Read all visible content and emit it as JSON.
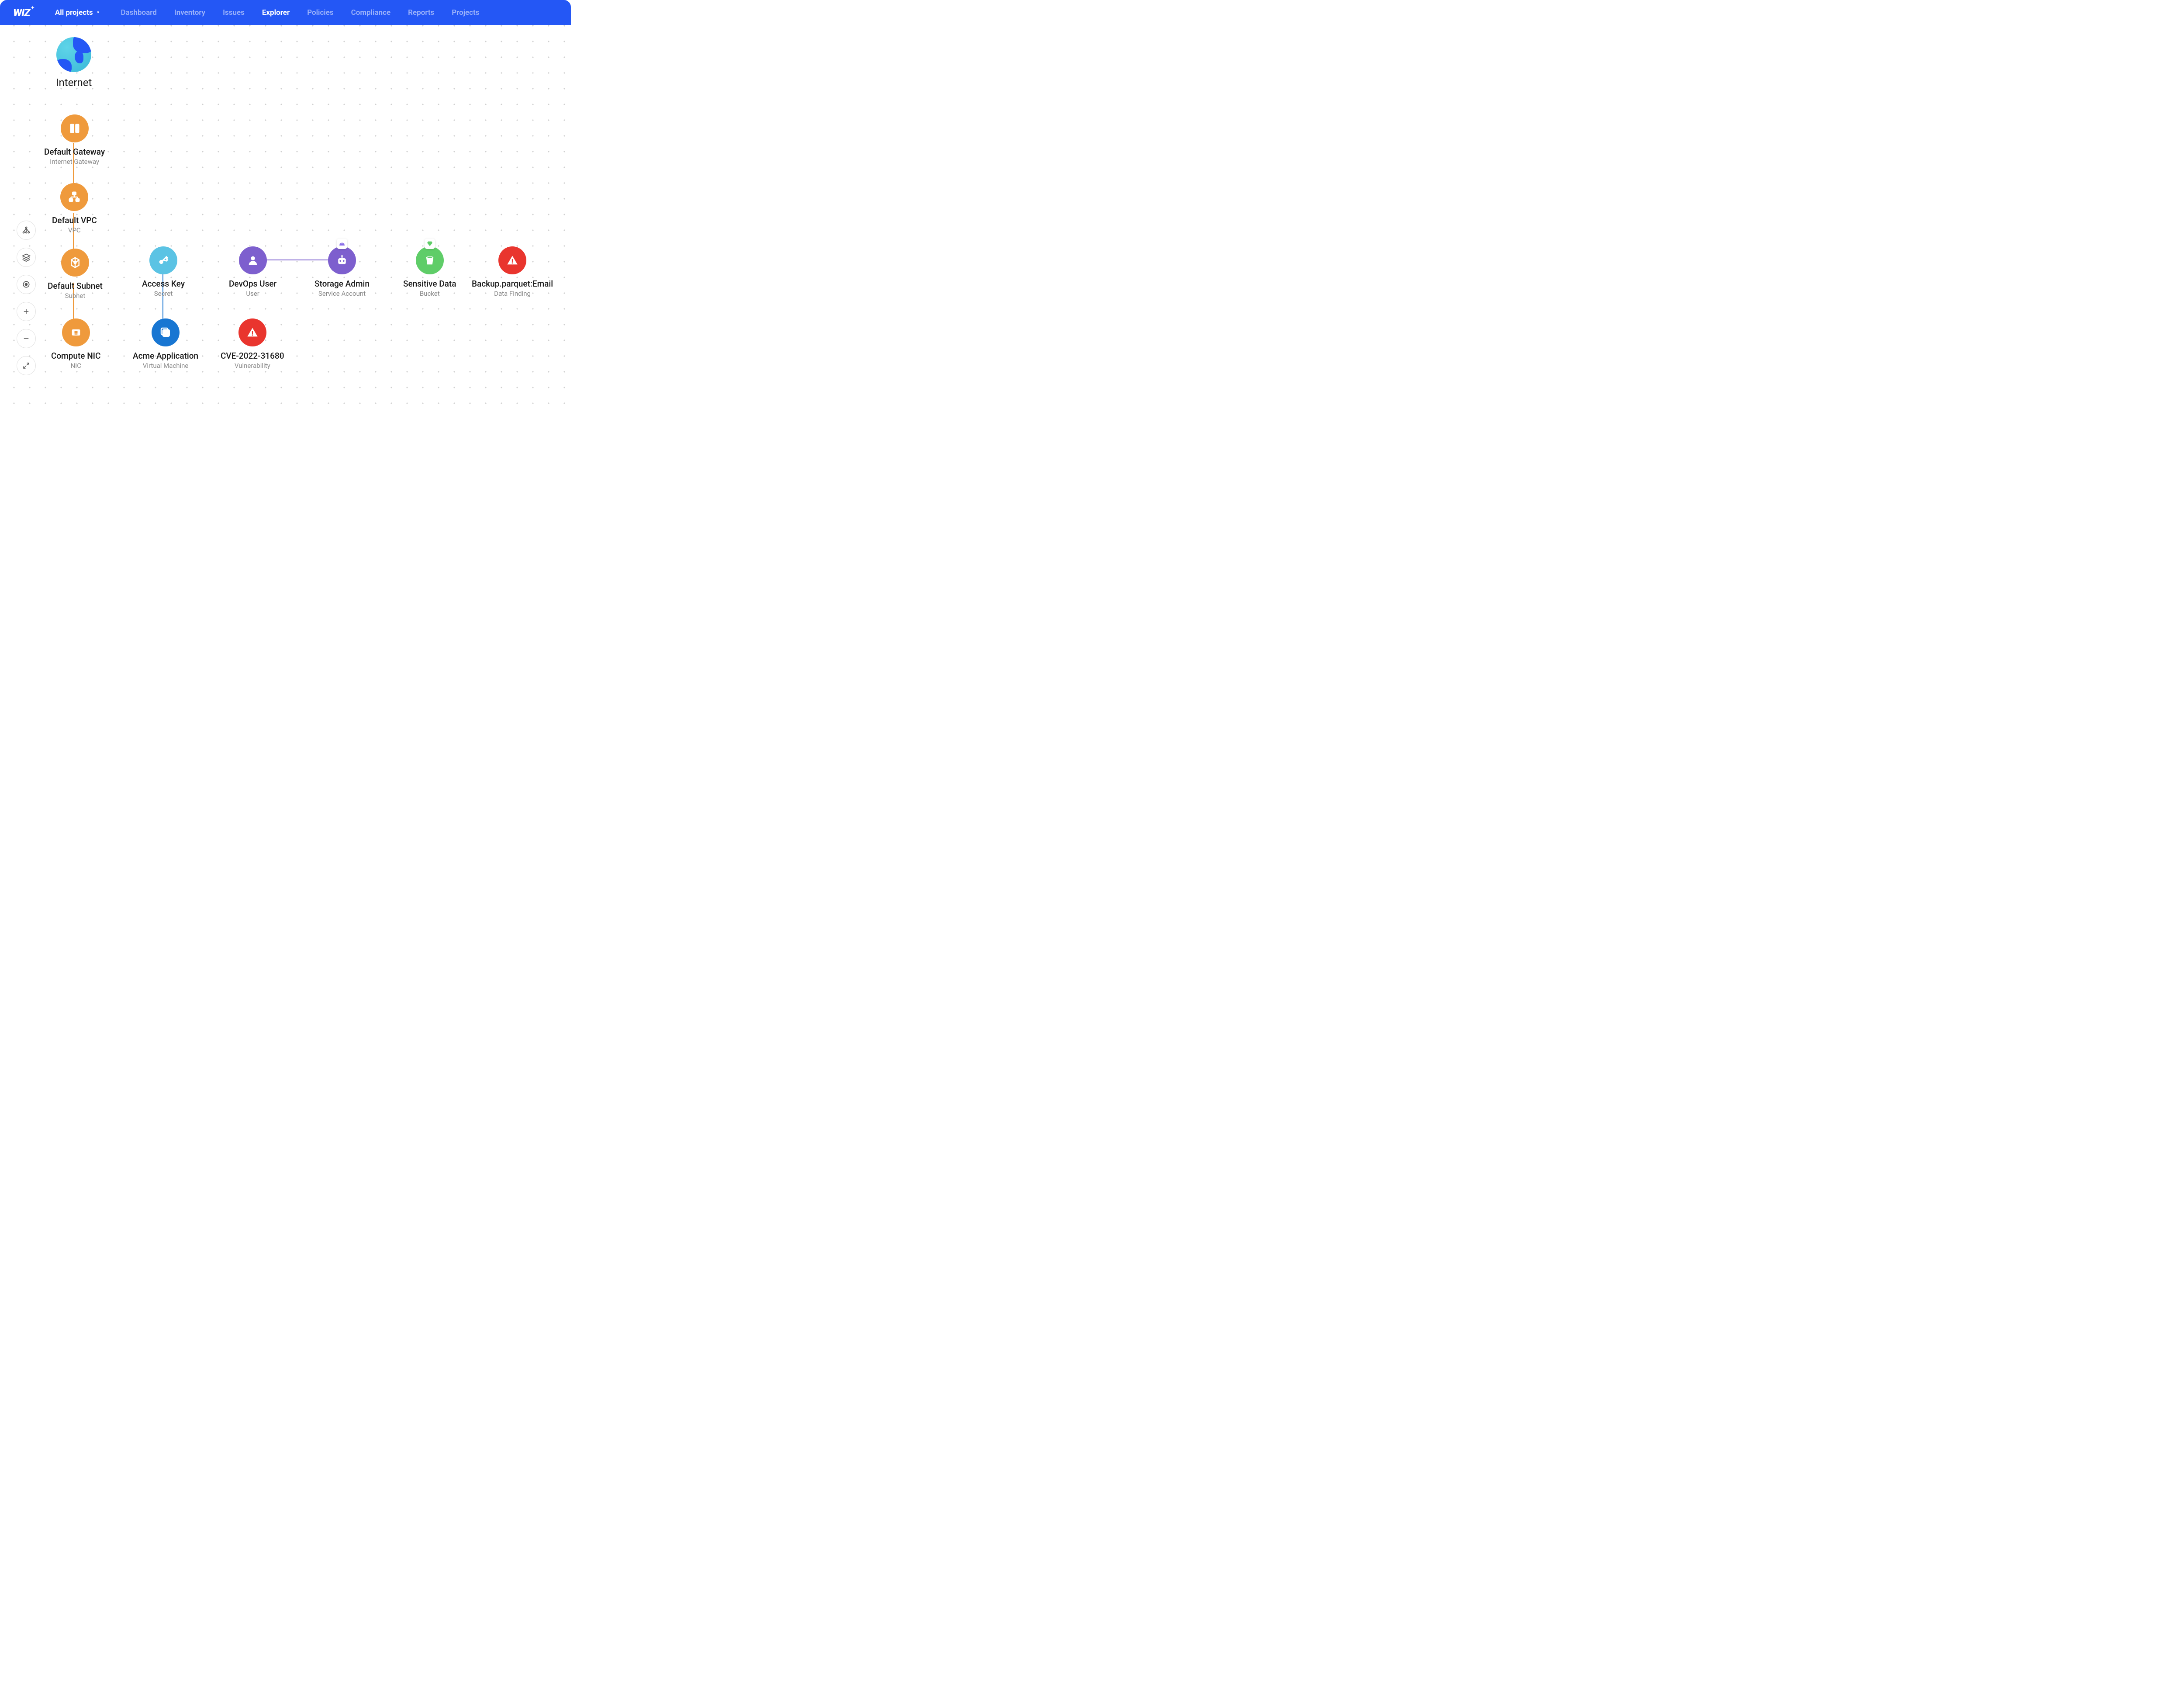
{
  "header": {
    "logo": "WIZ",
    "project_selector": "All projects",
    "nav": [
      "Dashboard",
      "Inventory",
      "Issues",
      "Explorer",
      "Policies",
      "Compliance",
      "Reports",
      "Projects"
    ],
    "active_nav": "Explorer"
  },
  "nodes": {
    "internet": {
      "title": "Internet",
      "subtitle": ""
    },
    "gateway": {
      "title": "Default Gateway",
      "subtitle": "Internet Gateway"
    },
    "vpc": {
      "title": "Default VPC",
      "subtitle": "VPC"
    },
    "subnet": {
      "title": "Default Subnet",
      "subtitle": "Subnet"
    },
    "nic": {
      "title": "Compute NIC",
      "subtitle": "NIC"
    },
    "accesskey": {
      "title": "Access Key",
      "subtitle": "Secret"
    },
    "app": {
      "title": "Acme Application",
      "subtitle": "Virtual Machine"
    },
    "cve": {
      "title": "CVE-2022-31680",
      "subtitle": "Vulnerability"
    },
    "devops": {
      "title": "DevOps User",
      "subtitle": "User"
    },
    "storageadmin": {
      "title": "Storage Admin",
      "subtitle": "Service Account"
    },
    "sensitive": {
      "title": "Sensitive Data",
      "subtitle": "Bucket"
    },
    "backup": {
      "title": "Backup.parquet:Email",
      "subtitle": "Data Finding"
    }
  },
  "badges": {
    "storageadmin": "crown",
    "sensitive": "diamond"
  },
  "tools": [
    "graph",
    "layers",
    "locate",
    "zoom-in",
    "zoom-out",
    "fullscreen"
  ],
  "colors": {
    "brand": "#2457F5",
    "orange": "#EF9A3C",
    "cyan": "#5BC3E4",
    "purple": "#7D5FCE",
    "blue": "#1876D2",
    "green": "#5FCD68",
    "red": "#E9352E"
  }
}
